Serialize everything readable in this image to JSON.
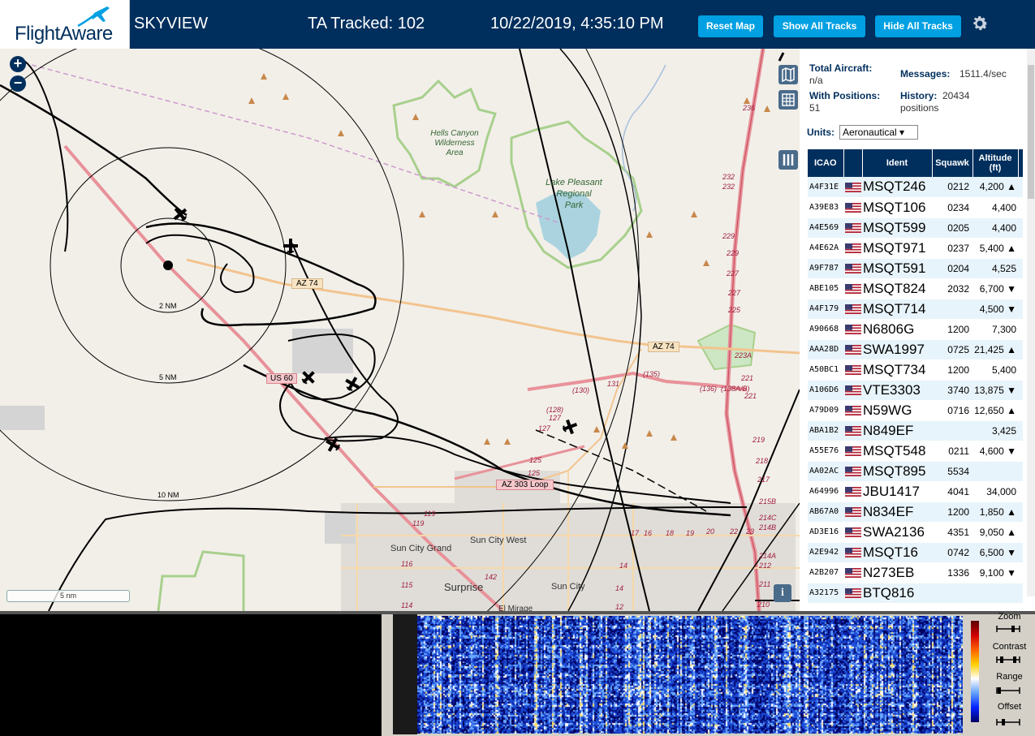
{
  "header": {
    "brand": "FlightAware",
    "app_name": "SKYVIEW",
    "tracked_label": "TA Tracked: 102",
    "datetime": "10/22/2019, 4:35:10 PM",
    "buttons": {
      "reset_map": "Reset Map",
      "show_all": "Show All Tracks",
      "hide_all": "Hide All Tracks"
    }
  },
  "map": {
    "zoom_in": "+",
    "zoom_out": "−",
    "scale_label": "5 nm",
    "info_label": "i",
    "range_labels": [
      "2 NM",
      "5 NM",
      "10 NM"
    ],
    "place_labels": {
      "hells_canyon_1": "Hells Canyon",
      "hells_canyon_2": "Wilderness",
      "hells_canyon_3": "Area",
      "lake_1": "Lake Pleasant",
      "lake_2": "Regional",
      "lake_3": "Park",
      "sun_city_west": "Sun City West",
      "sun_city_grand": "Sun City Grand",
      "surprise": "Surprise",
      "sun_city": "Sun City",
      "el_mirage": "El Mirage"
    },
    "road_labels": {
      "az74_a": "AZ 74",
      "az74_b": "AZ 74",
      "us60": "US 60",
      "az303": "AZ 303 Loop"
    },
    "route_numbers": [
      "236",
      "232",
      "232",
      "229",
      "229",
      "227",
      "227",
      "225",
      "223A",
      "221",
      "221",
      "219",
      "218",
      "217",
      "215B",
      "214C",
      "214B",
      "214A",
      "212",
      "211",
      "210",
      "131",
      "(135)",
      "(136)",
      "(138A/B)",
      "(130)",
      "(128)",
      "127",
      "127",
      "125",
      "125",
      "119",
      "119",
      "116",
      "115",
      "114",
      "142",
      "17",
      "16",
      "18",
      "19",
      "20",
      "22",
      "23",
      "14",
      "14",
      "12"
    ]
  },
  "sidebar": {
    "total_aircraft_label": "Total Aircraft:",
    "total_aircraft_value": "n/a",
    "with_positions_label": "With Positions:",
    "with_positions_value": "51",
    "messages_label": "Messages:",
    "messages_value": "1511.4/sec",
    "history_label": "History:",
    "history_value_1": "20434",
    "history_value_2": "positions",
    "units_label": "Units:",
    "units_value": "Aeronautical ▾",
    "columns": [
      "ICAO",
      "",
      "Ident",
      "Squawk",
      "Altitude (ft)"
    ],
    "rows": [
      {
        "icao": "A4F31E",
        "ident": "MSQT246",
        "squawk": "0212",
        "alt": "4,200 ▲"
      },
      {
        "icao": "A39E83",
        "ident": "MSQT106",
        "squawk": "0234",
        "alt": "4,400"
      },
      {
        "icao": "A4E569",
        "ident": "MSQT599",
        "squawk": "0205",
        "alt": "4,400"
      },
      {
        "icao": "A4E62A",
        "ident": "MSQT971",
        "squawk": "0237",
        "alt": "5,400 ▲"
      },
      {
        "icao": "A9F787",
        "ident": "MSQT591",
        "squawk": "0204",
        "alt": "4,525"
      },
      {
        "icao": "ABE105",
        "ident": "MSQT824",
        "squawk": "2032",
        "alt": "6,700 ▼"
      },
      {
        "icao": "A4F179",
        "ident": "MSQT714",
        "squawk": "",
        "alt": "4,500 ▼"
      },
      {
        "icao": "A90668",
        "ident": "N6806G",
        "squawk": "1200",
        "alt": "7,300"
      },
      {
        "icao": "AAA28D",
        "ident": "SWA1997",
        "squawk": "0725",
        "alt": "21,425 ▲"
      },
      {
        "icao": "A50BC1",
        "ident": "MSQT734",
        "squawk": "1200",
        "alt": "5,400"
      },
      {
        "icao": "A106D6",
        "ident": "VTE3303",
        "squawk": "3740",
        "alt": "13,875 ▼"
      },
      {
        "icao": "A79D09",
        "ident": "N59WG",
        "squawk": "0716",
        "alt": "12,650 ▲"
      },
      {
        "icao": "ABA1B2",
        "ident": "N849EF",
        "squawk": "",
        "alt": "3,425"
      },
      {
        "icao": "A55E76",
        "ident": "MSQT548",
        "squawk": "0211",
        "alt": "4,600 ▼"
      },
      {
        "icao": "AA02AC",
        "ident": "MSQT895",
        "squawk": "5534",
        "alt": ""
      },
      {
        "icao": "A64996",
        "ident": "JBU1417",
        "squawk": "4041",
        "alt": "34,000"
      },
      {
        "icao": "AB67A0",
        "ident": "N834EF",
        "squawk": "1200",
        "alt": "1,850 ▲"
      },
      {
        "icao": "AD3E16",
        "ident": "SWA2136",
        "squawk": "4351",
        "alt": "9,050 ▲"
      },
      {
        "icao": "A2E942",
        "ident": "MSQT16",
        "squawk": "0742",
        "alt": "6,500 ▼"
      },
      {
        "icao": "A2B207",
        "ident": "N273EB",
        "squawk": "1336",
        "alt": "9,100 ▼"
      },
      {
        "icao": "A32175",
        "ident": "BTQ816",
        "squawk": "",
        "alt": ""
      }
    ]
  },
  "spectrum": {
    "controls": [
      "Zoom",
      "Contrast",
      "Range",
      "Offset"
    ]
  },
  "colors": {
    "header_bg": "#002f5d",
    "button_bg": "#00a0e2",
    "table_header_bg": "#002f5d",
    "row_alt_bg": "#e8f4fb",
    "map_bg": "#f2efe9"
  }
}
